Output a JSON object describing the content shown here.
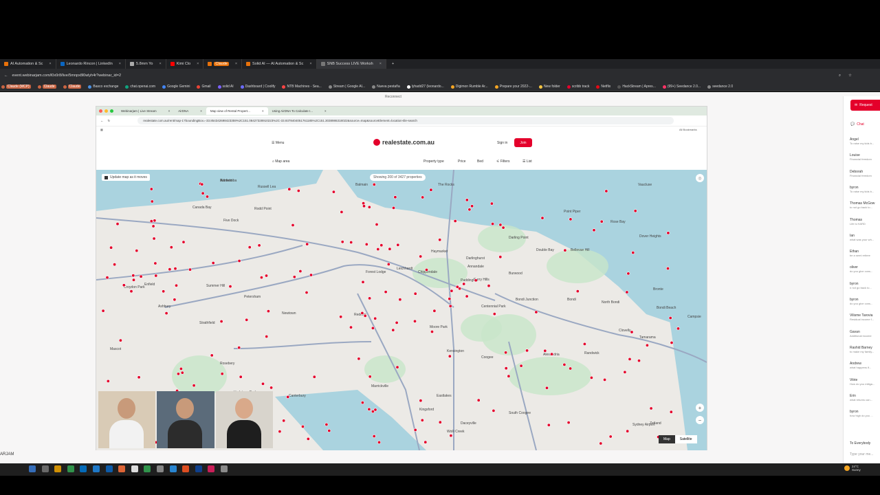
{
  "outer_tabs": [
    {
      "label": "AI Automation & Sc",
      "color": "#e8710a"
    },
    {
      "label": "Leonardo Rincon | LinkedIn",
      "color": "#0a66c2"
    },
    {
      "label": "5.8mm Yo",
      "color": "#aaaaaa"
    },
    {
      "label": "Kimi Clo",
      "color": "#ff0000"
    },
    {
      "label": "Claude",
      "color": "#e8710a",
      "active_badge": true
    },
    {
      "label": "Solid AI — AI Automation & Sc",
      "color": "#e8710a"
    },
    {
      "label": "SNB Success LIVE Worksh",
      "color": "#777777",
      "active": true
    }
  ],
  "outer_url": "event.webinarjam.com/l0x0r8/live/5mnpx8l0wlyh4r?webinar_id=2",
  "bookmarks": [
    "Claude (MCP)",
    "Claude",
    "Claude",
    "Basco exchange",
    "chat.openai.com",
    "Google Gemini",
    "Gmail",
    "solid AI",
    "Dashboard | Coolify",
    "NTB Machines - Sea...",
    "Stream | Google AI...",
    "Nueva pestaña",
    "lyhadd27 (leonardo...",
    "Digimon Rumble Ar...",
    "Prepare your 2022-...",
    "New folder",
    "scribb track",
    "Netflix",
    "HackStream | Apres...",
    "(99+) Seedance 2.0...",
    "seedance 2.0"
  ],
  "reconnect_text": "Reconnect",
  "inner_tabs": [
    {
      "label": "Webinarjam | Live Stream",
      "active": false
    },
    {
      "label": "AirDNA",
      "active": false
    },
    {
      "label": "Map view of Rental Propert...",
      "active": true
    },
    {
      "label": "Using AirDNA To Calculate I...",
      "active": false
    }
  ],
  "inner_url": "realestate.com.au/rent/map-1?boundingBox=-33.854342698423359%2C151.08427328910223%2C-33.9378404051761185%2C151.3038986318022&source=map&sourceElement=location-tile-search",
  "inner_bookmarks": "All Bookmarks",
  "site": {
    "menu": "Menu",
    "logo": "realestate.com.au",
    "signin": "Sign in",
    "join": "Join",
    "map_area": "Map area",
    "property_type": "Property type",
    "price": "Price",
    "bed": "Bed",
    "filters": "Filters",
    "list": "List"
  },
  "map": {
    "update_label": "Update map as it moves",
    "showing": "Showing 200 of 3427 properties",
    "btn_map": "Map",
    "btn_satellite": "Satellite",
    "zoom_in": "+",
    "zoom_out": "−",
    "suburbs": [
      "Wareemba",
      "Russell Lea",
      "Balmain",
      "The Rocks",
      "Vaucluse",
      "Canada Bay",
      "Rodd Point",
      "Five Dock",
      "Point Piper",
      "Rose Bay",
      "Dover Heights",
      "Darling Point",
      "Double Bay",
      "Bellevue Hill",
      "Haymarket",
      "Darlinghurst",
      "Annandale",
      "Leichhardt",
      "Forest Lodge",
      "Chippendale",
      "Surry Hills",
      "Paddington",
      "Burwood",
      "Enfield",
      "Croydon Park",
      "Ashbury",
      "Strathfield",
      "Summer Hill",
      "Petersham",
      "Newtown",
      "Redfern",
      "Moore Park",
      "Centennial Park",
      "Bondi Junction",
      "Bondi",
      "North Bondi",
      "Bondi Beach",
      "Tamarama",
      "Bronte",
      "Clovelly",
      "Randwick",
      "Kensington",
      "Coogee",
      "Alexandria",
      "Zetland",
      "Marrickville",
      "Campsie",
      "Canterbury",
      "Hurlstone Park",
      "Belfield",
      "Rosebery",
      "Mascot",
      "Eastlakes",
      "Kingsford",
      "Daceyville",
      "South Coogee",
      "Wolli Creek",
      "Sydney Airport",
      "Ashfield"
    ]
  },
  "chat": {
    "request_button": "Request",
    "tab": "Chat",
    "messages": [
      {
        "name": "Angel",
        "text": "To raise my kids b..."
      },
      {
        "name": "Louise",
        "text": "Financial freedom"
      },
      {
        "name": "Deborah",
        "text": "Financial freedom"
      },
      {
        "name": "byron",
        "text": "To raise my kids b..."
      },
      {
        "name": "Thomas McGow",
        "text": "to not go back to..."
      },
      {
        "name": "Thomas",
        "text": "Life is HARD"
      },
      {
        "name": "Ian",
        "text": "what was your wh..."
      },
      {
        "name": "Ethan",
        "text": "be a semi retiree"
      },
      {
        "name": "oliver",
        "text": "do you give cons..."
      },
      {
        "name": "byron",
        "text": "n not go back to..."
      },
      {
        "name": "byron",
        "text": "do you give cons..."
      },
      {
        "name": "Vilisme Tarovia",
        "text": "Residual income f..."
      },
      {
        "name": "Gavan",
        "text": "Additional income"
      },
      {
        "name": "Rashid Barney",
        "text": "to make my family..."
      },
      {
        "name": "Andrew",
        "text": "what happens if..."
      },
      {
        "name": "Vitrie",
        "text": "How do you mitiga..."
      },
      {
        "name": "Erin",
        "text": "what returns can..."
      },
      {
        "name": "byron",
        "text": "how high do you ..."
      }
    ],
    "to_everybody": "To Everybody",
    "type_message": "Type your me..."
  },
  "presenter_name": "ARJAM",
  "weather": {
    "temp": "24°C",
    "desc": "Sunny"
  },
  "colors": {
    "brand_red": "#e4002b",
    "map_bg": "#eceae6",
    "water": "#aad3df",
    "park": "#c8e6c9"
  }
}
